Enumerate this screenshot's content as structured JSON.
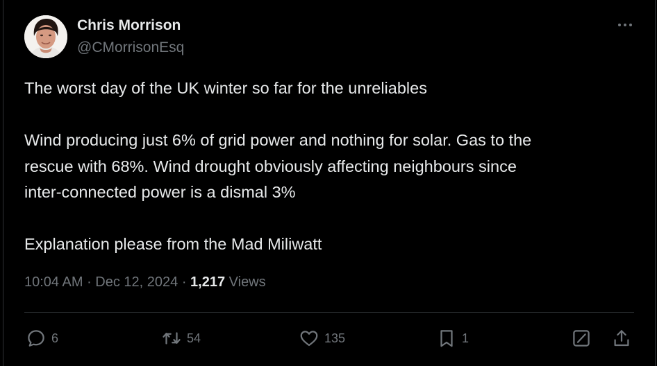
{
  "tweet": {
    "author": {
      "name": "Chris Morrison",
      "handle": "@CMorrisonEsq"
    },
    "text": {
      "line1": "The worst day of the UK winter so far for the unreliables",
      "line2": "Wind producing just 6% of grid power and nothing for solar. Gas to the",
      "line3": "rescue with 68%. Wind drought obviously affecting neighbours since",
      "line4": "inter-connected power is a dismal 3%",
      "line5": "Explanation please from the Mad Miliwatt"
    },
    "meta": {
      "time": "10:04 AM",
      "separator": "·",
      "date": "Dec 12, 2024",
      "views_count": "1,217",
      "views_label": "Views"
    },
    "actions": {
      "replies": "6",
      "reposts": "54",
      "likes": "135",
      "bookmarks": "1"
    }
  },
  "icons": {
    "more": "more-horizontal-icon",
    "reply": "reply-icon",
    "repost": "repost-icon",
    "like": "heart-icon",
    "bookmark": "bookmark-icon",
    "grok": "grok-icon",
    "share": "share-icon"
  },
  "colors": {
    "background": "#000000",
    "text_primary": "#e7e9ea",
    "text_secondary": "#71767b",
    "divider": "#2f3336"
  }
}
